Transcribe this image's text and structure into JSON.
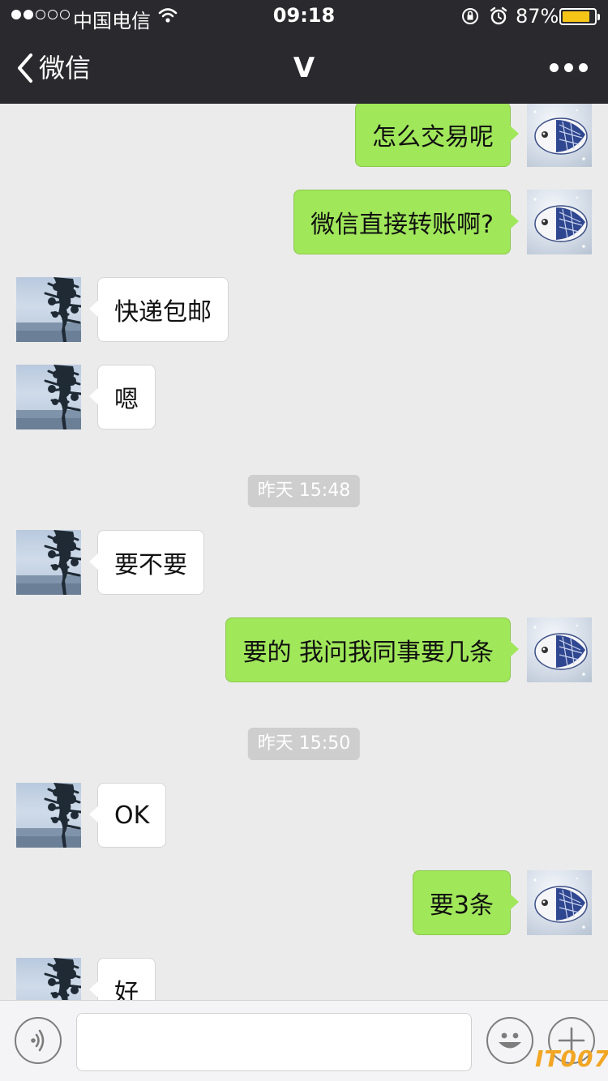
{
  "status_bar": {
    "carrier": "中国电信",
    "time": "09:18",
    "battery_percent": "87%",
    "battery_level": 0.87,
    "signal_bars": 2,
    "signal_total": 5
  },
  "nav": {
    "back_label": "微信",
    "title": "V",
    "more_icon": "more-dots-icon"
  },
  "messages": [
    {
      "from": "me",
      "text": "怎么交易呢"
    },
    {
      "from": "me",
      "text": "微信直接转账啊?"
    },
    {
      "from": "them",
      "text": "快递包邮"
    },
    {
      "from": "them",
      "text": "嗯"
    },
    {
      "type": "time",
      "text": "昨天 15:48"
    },
    {
      "from": "them",
      "text": "要不要"
    },
    {
      "from": "me",
      "text": "要的 我问我同事要几条"
    },
    {
      "type": "time",
      "text": "昨天 15:50"
    },
    {
      "from": "them",
      "text": "OK"
    },
    {
      "from": "me",
      "text": "要3条"
    },
    {
      "from": "them",
      "text": "好"
    }
  ],
  "input": {
    "value": "",
    "placeholder": ""
  },
  "watermark": "IT007",
  "colors": {
    "bar_bg": "#2a2a2e",
    "chat_bg": "#ebebeb",
    "my_bubble": "#a0e75a",
    "their_bubble": "#ffffff",
    "battery": "#f5c518",
    "watermark": "#f2a623"
  }
}
